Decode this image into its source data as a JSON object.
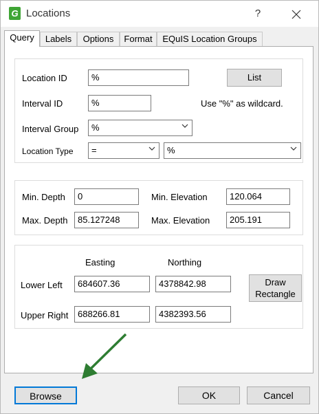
{
  "window": {
    "title": "Locations",
    "help_glyph": "?",
    "close_glyph": "✕",
    "app_icon_glyph": "G"
  },
  "tabs": [
    {
      "label": "Query"
    },
    {
      "label": "Labels"
    },
    {
      "label": "Options"
    },
    {
      "label": "Format"
    },
    {
      "label": "EQuIS Location Groups"
    }
  ],
  "query": {
    "location_id_label": "Location ID",
    "location_id_value": "%",
    "list_button": "List",
    "interval_id_label": "Interval ID",
    "interval_id_value": "%",
    "wildcard_hint": "Use \"%\" as wildcard.",
    "interval_group_label": "Interval Group",
    "interval_group_value": "%",
    "location_type_label": "Location Type",
    "location_type_operator": "=",
    "location_type_value": "%"
  },
  "depth": {
    "min_depth_label": "Min. Depth",
    "min_depth_value": "0",
    "max_depth_label": "Max. Depth",
    "max_depth_value": "85.127248",
    "min_elev_label": "Min. Elevation",
    "min_elev_value": "120.064",
    "max_elev_label": "Max. Elevation",
    "max_elev_value": "205.191"
  },
  "extent": {
    "easting_label": "Easting",
    "northing_label": "Northing",
    "lower_left_label": "Lower Left",
    "lower_left_easting": "684607.36",
    "lower_left_northing": "4378842.98",
    "upper_right_label": "Upper Right",
    "upper_right_easting": "688266.81",
    "upper_right_northing": "4382393.56",
    "draw_rectangle_button": "Draw Rectangle"
  },
  "footer": {
    "browse_button": "Browse",
    "ok_button": "OK",
    "cancel_button": "Cancel"
  },
  "colors": {
    "annotation_arrow": "#2e7d32",
    "app_icon": "#3fa535",
    "focus_border": "#0078d7"
  }
}
